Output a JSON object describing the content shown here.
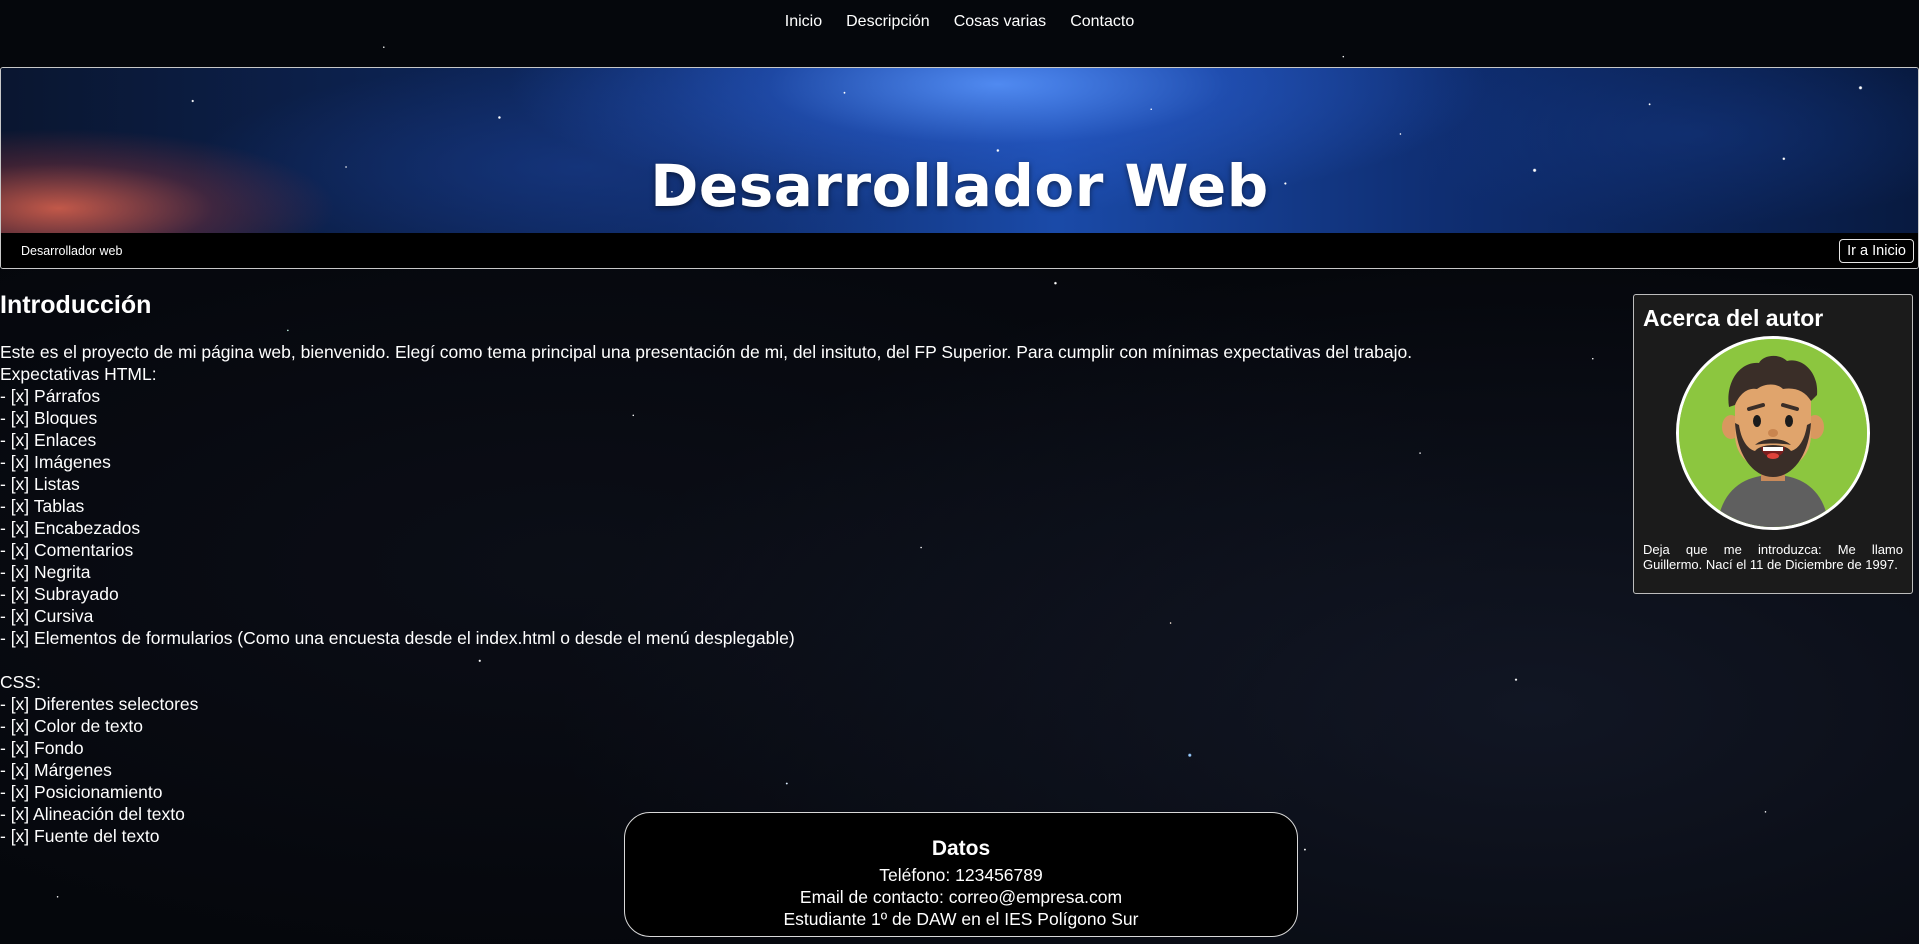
{
  "nav": {
    "items": [
      "Inicio",
      "Descripción",
      "Cosas varias",
      "Contacto"
    ]
  },
  "header": {
    "title": "Desarrollador Web",
    "subtitle": "Desarrollador web",
    "home_button": "Ir a Inicio"
  },
  "main": {
    "heading": "Introducción",
    "intro": "Este es el proyecto de mi página web, bienvenido. Elegí como tema principal una presentación de mi, del insituto, del FP Superior. Para cumplir con mínimas expectativas del trabajo.",
    "html_label": "Expectativas HTML:",
    "html_items": [
      "- [x] Párrafos",
      "- [x] Bloques",
      "- [x] Enlaces",
      "- [x] Imágenes",
      "- [x] Listas",
      "- [x] Tablas",
      "- [x] Encabezados",
      "- [x] Comentarios",
      "- [x] Negrita",
      "- [x] Subrayado",
      "- [x] Cursiva",
      "- [x] Elementos de formularios (Como una encuesta desde el index.html o desde el menú desplegable)"
    ],
    "css_label": "CSS:",
    "css_items": [
      "- [x] Diferentes selectores",
      "- [x] Color de texto",
      "- [x] Fondo",
      "- [x] Márgenes",
      "- [x] Posicionamiento",
      "- [x] Alineación del texto",
      "- [x] Fuente del texto"
    ]
  },
  "aside": {
    "title": "Acerca del autor",
    "avatar_icon": "bearded-man-avatar",
    "text": "Deja que me introduzca: Me llamo Guillermo. Nací el 11 de Diciembre de 1997."
  },
  "footer": {
    "title": "Datos",
    "phone": "Teléfono: 123456789",
    "email": "Email de contacto: correo@empresa.com",
    "student": "Estudiante 1º de DAW en el IES Polígono Sur"
  },
  "colors": {
    "background": "#05070c",
    "avatar_bg": "#8cc63f",
    "panel_bg": "#1b1b1b"
  }
}
